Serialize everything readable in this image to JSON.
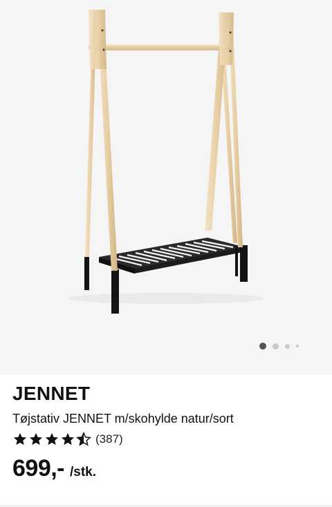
{
  "product": {
    "name": "JENNET",
    "description": "Tøjstativ JENNET m/skohylde natur/sort",
    "rating": {
      "stars": 4.5,
      "max_stars": 5,
      "count_label": "(387)"
    },
    "price": "699,-",
    "unit": "/stk."
  },
  "gallery": {
    "image_count": 4,
    "active_index": 0
  },
  "colors": {
    "wood": "#e9d3ad",
    "shelf": "#1a1a1a",
    "background": "#f5f5f5",
    "active_dot": "#555555",
    "inactive_dot": "#c9c9c9"
  }
}
